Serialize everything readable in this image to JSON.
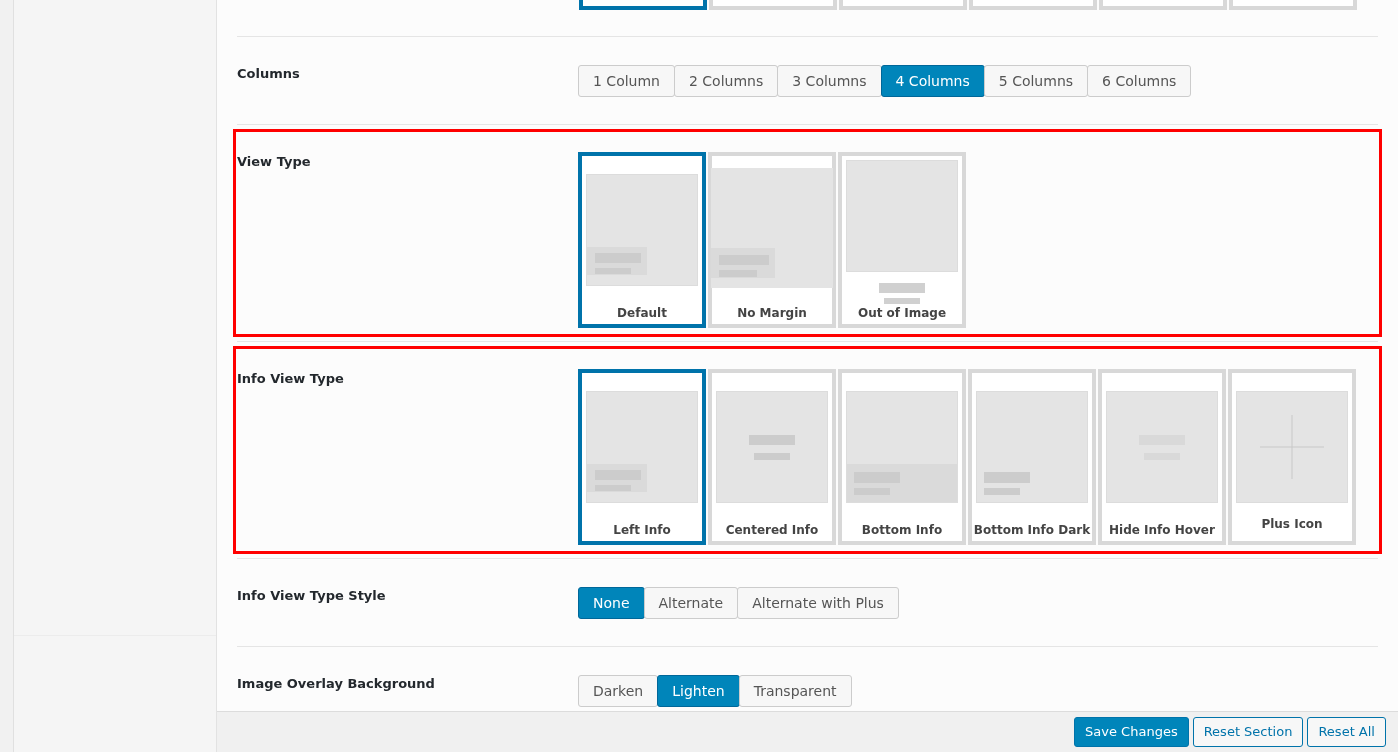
{
  "top_layouts": [
    {
      "selected": true
    },
    {
      "selected": false
    },
    {
      "selected": false
    },
    {
      "selected": false
    },
    {
      "selected": false
    },
    {
      "selected": false
    }
  ],
  "sections": [
    {
      "kind": "buttons",
      "label": "Columns",
      "highlighted": false,
      "options": [
        {
          "label": "1 Column",
          "selected": false
        },
        {
          "label": "2 Columns",
          "selected": false
        },
        {
          "label": "3 Columns",
          "selected": false
        },
        {
          "label": "4 Columns",
          "selected": true
        },
        {
          "label": "5 Columns",
          "selected": false
        },
        {
          "label": "6 Columns",
          "selected": false
        }
      ]
    },
    {
      "kind": "images",
      "label": "View Type",
      "highlighted": true,
      "options": [
        {
          "label": "Default",
          "kind": "default",
          "selected": true
        },
        {
          "label": "No Margin",
          "kind": "no_margin",
          "selected": false
        },
        {
          "label": "Out of Image",
          "kind": "out_of_image",
          "selected": false
        }
      ]
    },
    {
      "kind": "images",
      "label": "Info View Type",
      "highlighted": true,
      "options": [
        {
          "label": "Left Info",
          "kind": "left_info",
          "selected": true
        },
        {
          "label": "Centered Info",
          "kind": "centered_info",
          "selected": false
        },
        {
          "label": "Bottom Info",
          "kind": "bottom_info",
          "selected": false
        },
        {
          "label": "Bottom Info Dark",
          "kind": "bottom_info_dark",
          "selected": false
        },
        {
          "label": "Hide Info Hover",
          "kind": "hide_info_hover",
          "selected": false
        },
        {
          "label": "Plus Icon",
          "kind": "plus_icon",
          "selected": false
        }
      ]
    },
    {
      "kind": "buttons",
      "label": "Info View Type Style",
      "highlighted": false,
      "options": [
        {
          "label": "None",
          "selected": true
        },
        {
          "label": "Alternate",
          "selected": false
        },
        {
          "label": "Alternate with Plus",
          "selected": false
        }
      ]
    },
    {
      "kind": "buttons",
      "label": "Image Overlay Background",
      "highlighted": false,
      "options": [
        {
          "label": "Darken",
          "selected": false
        },
        {
          "label": "Lighten",
          "selected": true
        },
        {
          "label": "Transparent",
          "selected": false
        }
      ]
    }
  ],
  "footer": {
    "buttons": [
      {
        "label": "Save Changes",
        "primary": true
      },
      {
        "label": "Reset Section",
        "primary": false
      },
      {
        "label": "Reset All",
        "primary": false
      }
    ]
  }
}
